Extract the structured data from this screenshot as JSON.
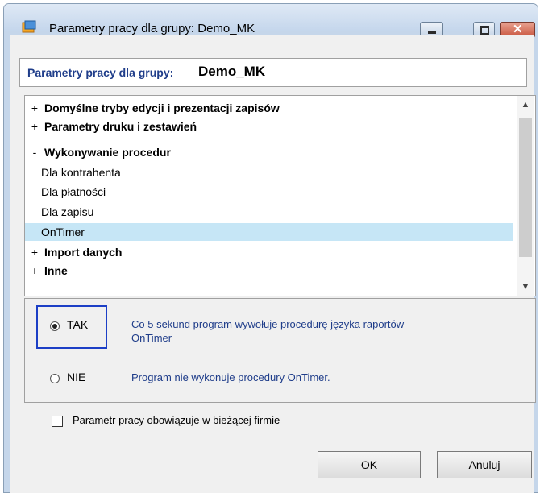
{
  "window": {
    "title": "Parametry pracy dla grupy: Demo_MK"
  },
  "header": {
    "label": "Parametry pracy dla grupy:",
    "value": "Demo_MK"
  },
  "tree": {
    "items": [
      {
        "sign": "+",
        "label": "Domyślne tryby edycji i prezentacji zapisów"
      },
      {
        "sign": "+",
        "label": "Parametry druku i zestawień"
      },
      {
        "sign": "-",
        "label": "Wykonywanie procedur"
      },
      {
        "label": "Dla kontrahenta"
      },
      {
        "label": "Dla płatności"
      },
      {
        "label": "Dla zapisu"
      },
      {
        "label": "OnTimer"
      },
      {
        "sign": "+",
        "label": "Import danych"
      },
      {
        "sign": "+",
        "label": "Inne"
      }
    ]
  },
  "options": {
    "tak": {
      "label": "TAK",
      "description_line1": "Co 5 sekund program wywołuje procedurę języka raportów",
      "description_line2": "OnTimer",
      "selected": true
    },
    "nie": {
      "label": "NIE",
      "description": "Program nie wykonuje procedury OnTimer.",
      "selected": false
    }
  },
  "checkbox": {
    "label": "Parametr pracy obowiązuje w bieżącej firmie",
    "checked": false
  },
  "buttons": {
    "ok": "OK",
    "cancel": "Anuluj"
  },
  "colors": {
    "selection": "#c6e6f6",
    "focus_border": "#1c3fc6",
    "description_text": "#1f3d8a"
  }
}
